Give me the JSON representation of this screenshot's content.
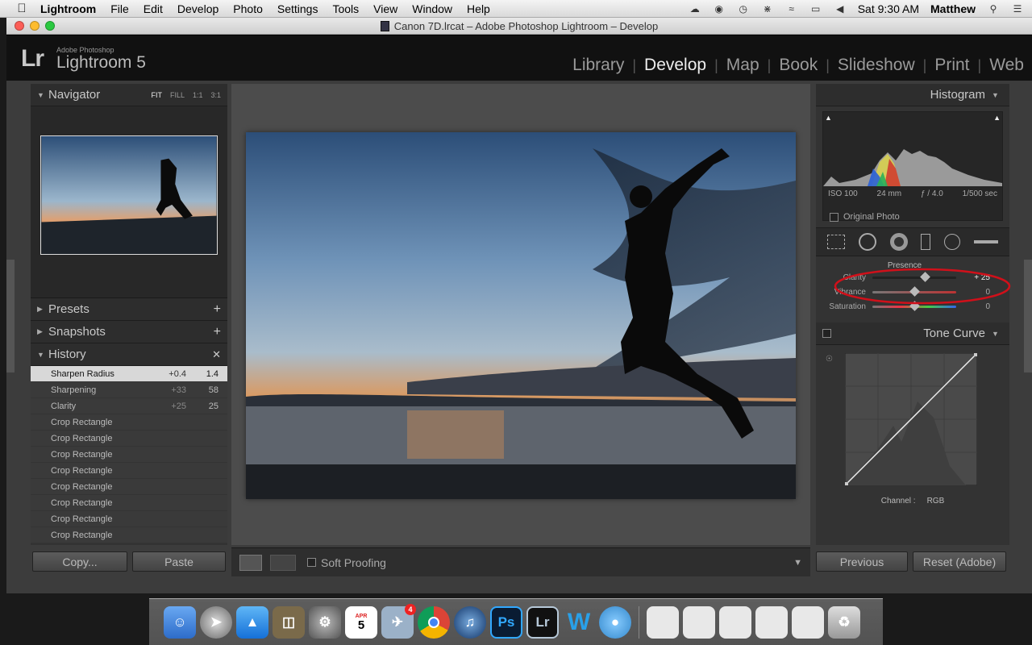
{
  "menubar": {
    "app": "Lightroom",
    "items": [
      "File",
      "Edit",
      "Develop",
      "Photo",
      "Settings",
      "Tools",
      "View",
      "Window",
      "Help"
    ],
    "clock": "Sat 9:30 AM",
    "user": "Matthew"
  },
  "window": {
    "title": "Canon 7D.lrcat – Adobe Photoshop Lightroom – Develop"
  },
  "header": {
    "logo_mark": "Lr",
    "logo_sub": "Adobe Photoshop",
    "logo_main": "Lightroom 5",
    "modules": [
      "Library",
      "Develop",
      "Map",
      "Book",
      "Slideshow",
      "Print",
      "Web"
    ],
    "active_module": "Develop"
  },
  "left_panel": {
    "navigator": {
      "title": "Navigator",
      "zoom": [
        "FIT",
        "FILL",
        "1:1",
        "3:1"
      ]
    },
    "presets": "Presets",
    "snapshots": "Snapshots",
    "history": {
      "title": "History",
      "rows": [
        {
          "name": "Sharpen Radius",
          "delta": "+0.4",
          "value": "1.4"
        },
        {
          "name": "Sharpening",
          "delta": "+33",
          "value": "58"
        },
        {
          "name": "Clarity",
          "delta": "+25",
          "value": "25"
        },
        {
          "name": "Crop Rectangle",
          "delta": "",
          "value": ""
        },
        {
          "name": "Crop Rectangle",
          "delta": "",
          "value": ""
        },
        {
          "name": "Crop Rectangle",
          "delta": "",
          "value": ""
        },
        {
          "name": "Crop Rectangle",
          "delta": "",
          "value": ""
        },
        {
          "name": "Crop Rectangle",
          "delta": "",
          "value": ""
        },
        {
          "name": "Crop Rectangle",
          "delta": "",
          "value": ""
        },
        {
          "name": "Crop Rectangle",
          "delta": "",
          "value": ""
        },
        {
          "name": "Crop Rectangle",
          "delta": "",
          "value": ""
        }
      ]
    },
    "copy_label": "Copy...",
    "paste_label": "Paste"
  },
  "toolbar": {
    "soft_proofing": "Soft Proofing"
  },
  "right_panel": {
    "histogram_title": "Histogram",
    "exif": {
      "iso": "ISO 100",
      "focal": "24 mm",
      "aperture": "ƒ / 4.0",
      "shutter": "1/500 sec"
    },
    "original_photo": "Original Photo",
    "presence": {
      "title": "Presence",
      "sliders": [
        {
          "label": "Clarity",
          "value": "+ 25",
          "level": 0.625
        },
        {
          "label": "Vibrance",
          "value": "0",
          "level": 0.5
        },
        {
          "label": "Saturation",
          "value": "0",
          "level": 0.5
        }
      ]
    },
    "tone_curve_title": "Tone Curve",
    "channel_label": "Channel :",
    "channel_value": "RGB",
    "previous_label": "Previous",
    "reset_label": "Reset (Adobe)"
  },
  "dock": {
    "calendar_month": "APR",
    "calendar_day": "5",
    "badge": "4",
    "ps": "Ps",
    "lr": "Lr",
    "w": "W"
  },
  "colors": {
    "annotation": "#d0101a",
    "bg": "#3c3c3c"
  }
}
